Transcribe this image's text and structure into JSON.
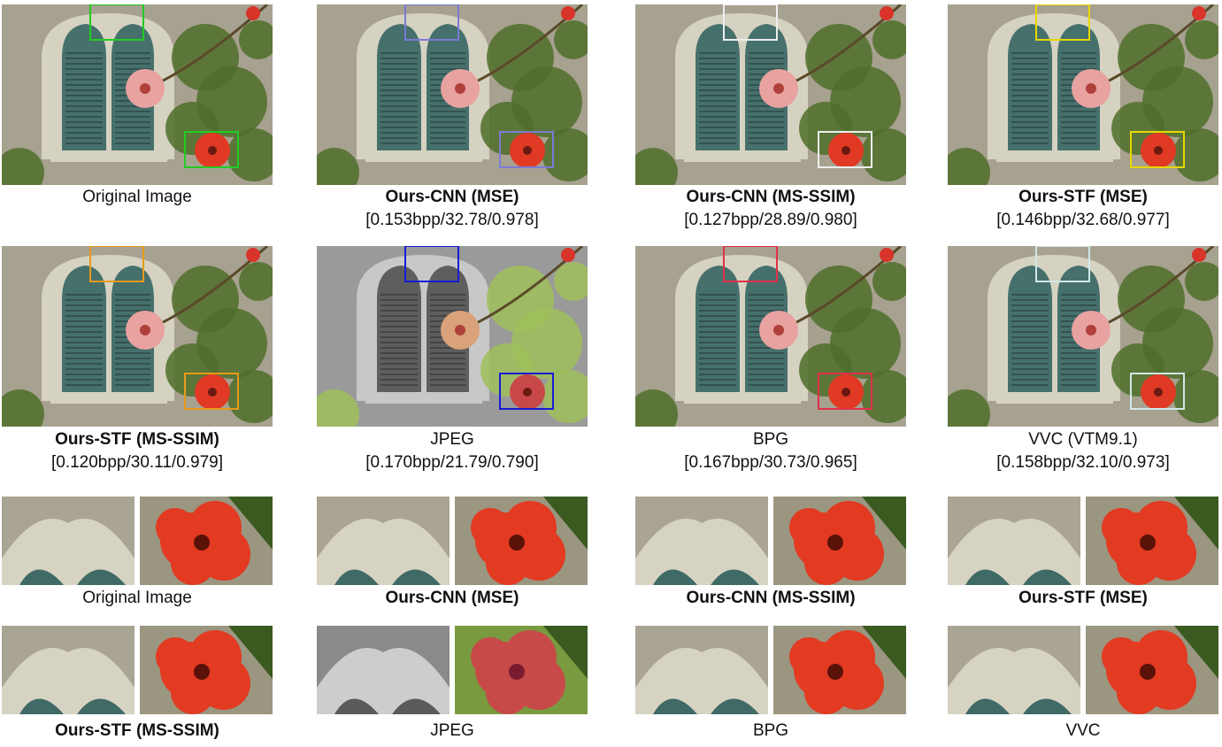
{
  "colors": {
    "original": "#22cc22",
    "ours_cnn_mse": "#7b7bd6",
    "ours_cnn_msssim": "#eeeeee",
    "ours_stf_mse": "#e8d800",
    "ours_stf_msssim": "#e89a1a",
    "jpeg": "#1a1ad6",
    "bpg": "#e0304a",
    "vvc": "#cfe8e8"
  },
  "panels": [
    {
      "name": "Original Image",
      "bold": false,
      "stats": "",
      "box_color": "#22cc22",
      "style": "normal"
    },
    {
      "name": "Ours-CNN (MSE)",
      "bold": true,
      "stats": "[0.153bpp/32.78/0.978]",
      "box_color": "#7b7bd6",
      "style": "normal"
    },
    {
      "name": "Ours-CNN (MS-SSIM)",
      "bold": true,
      "stats": "[0.127bpp/28.89/0.980]",
      "box_color": "#eeeeee",
      "style": "normal"
    },
    {
      "name": "Ours-STF (MSE)",
      "bold": true,
      "stats": "[0.146bpp/32.68/0.977]",
      "box_color": "#e8d800",
      "style": "normal"
    },
    {
      "name": "Ours-STF (MS-SSIM)",
      "bold": true,
      "stats": "[0.120bpp/30.11/0.979]",
      "box_color": "#e89a1a",
      "style": "normal"
    },
    {
      "name": "JPEG",
      "bold": false,
      "stats": "[0.170bpp/21.79/0.790]",
      "box_color": "#1a1ad6",
      "style": "jpeg"
    },
    {
      "name": "BPG",
      "bold": false,
      "stats": "[0.167bpp/30.73/0.965]",
      "box_color": "#e0304a",
      "style": "normal"
    },
    {
      "name": "VVC (VTM9.1)",
      "bold": false,
      "stats": "[0.158bpp/32.10/0.973]",
      "box_color": "#cfe8e8",
      "style": "normal"
    }
  ],
  "crops": [
    {
      "name": "Original Image",
      "bold": false,
      "style": "normal"
    },
    {
      "name": "Ours-CNN (MSE)",
      "bold": true,
      "style": "normal"
    },
    {
      "name": "Ours-CNN (MS-SSIM)",
      "bold": true,
      "style": "normal"
    },
    {
      "name": "Ours-STF (MSE)",
      "bold": true,
      "style": "normal"
    },
    {
      "name": "Ours-STF (MS-SSIM)",
      "bold": true,
      "style": "normal"
    },
    {
      "name": "JPEG",
      "bold": false,
      "style": "jpeg"
    },
    {
      "name": "BPG",
      "bold": false,
      "style": "normal"
    },
    {
      "name": "VVC",
      "bold": false,
      "style": "normal"
    }
  ]
}
